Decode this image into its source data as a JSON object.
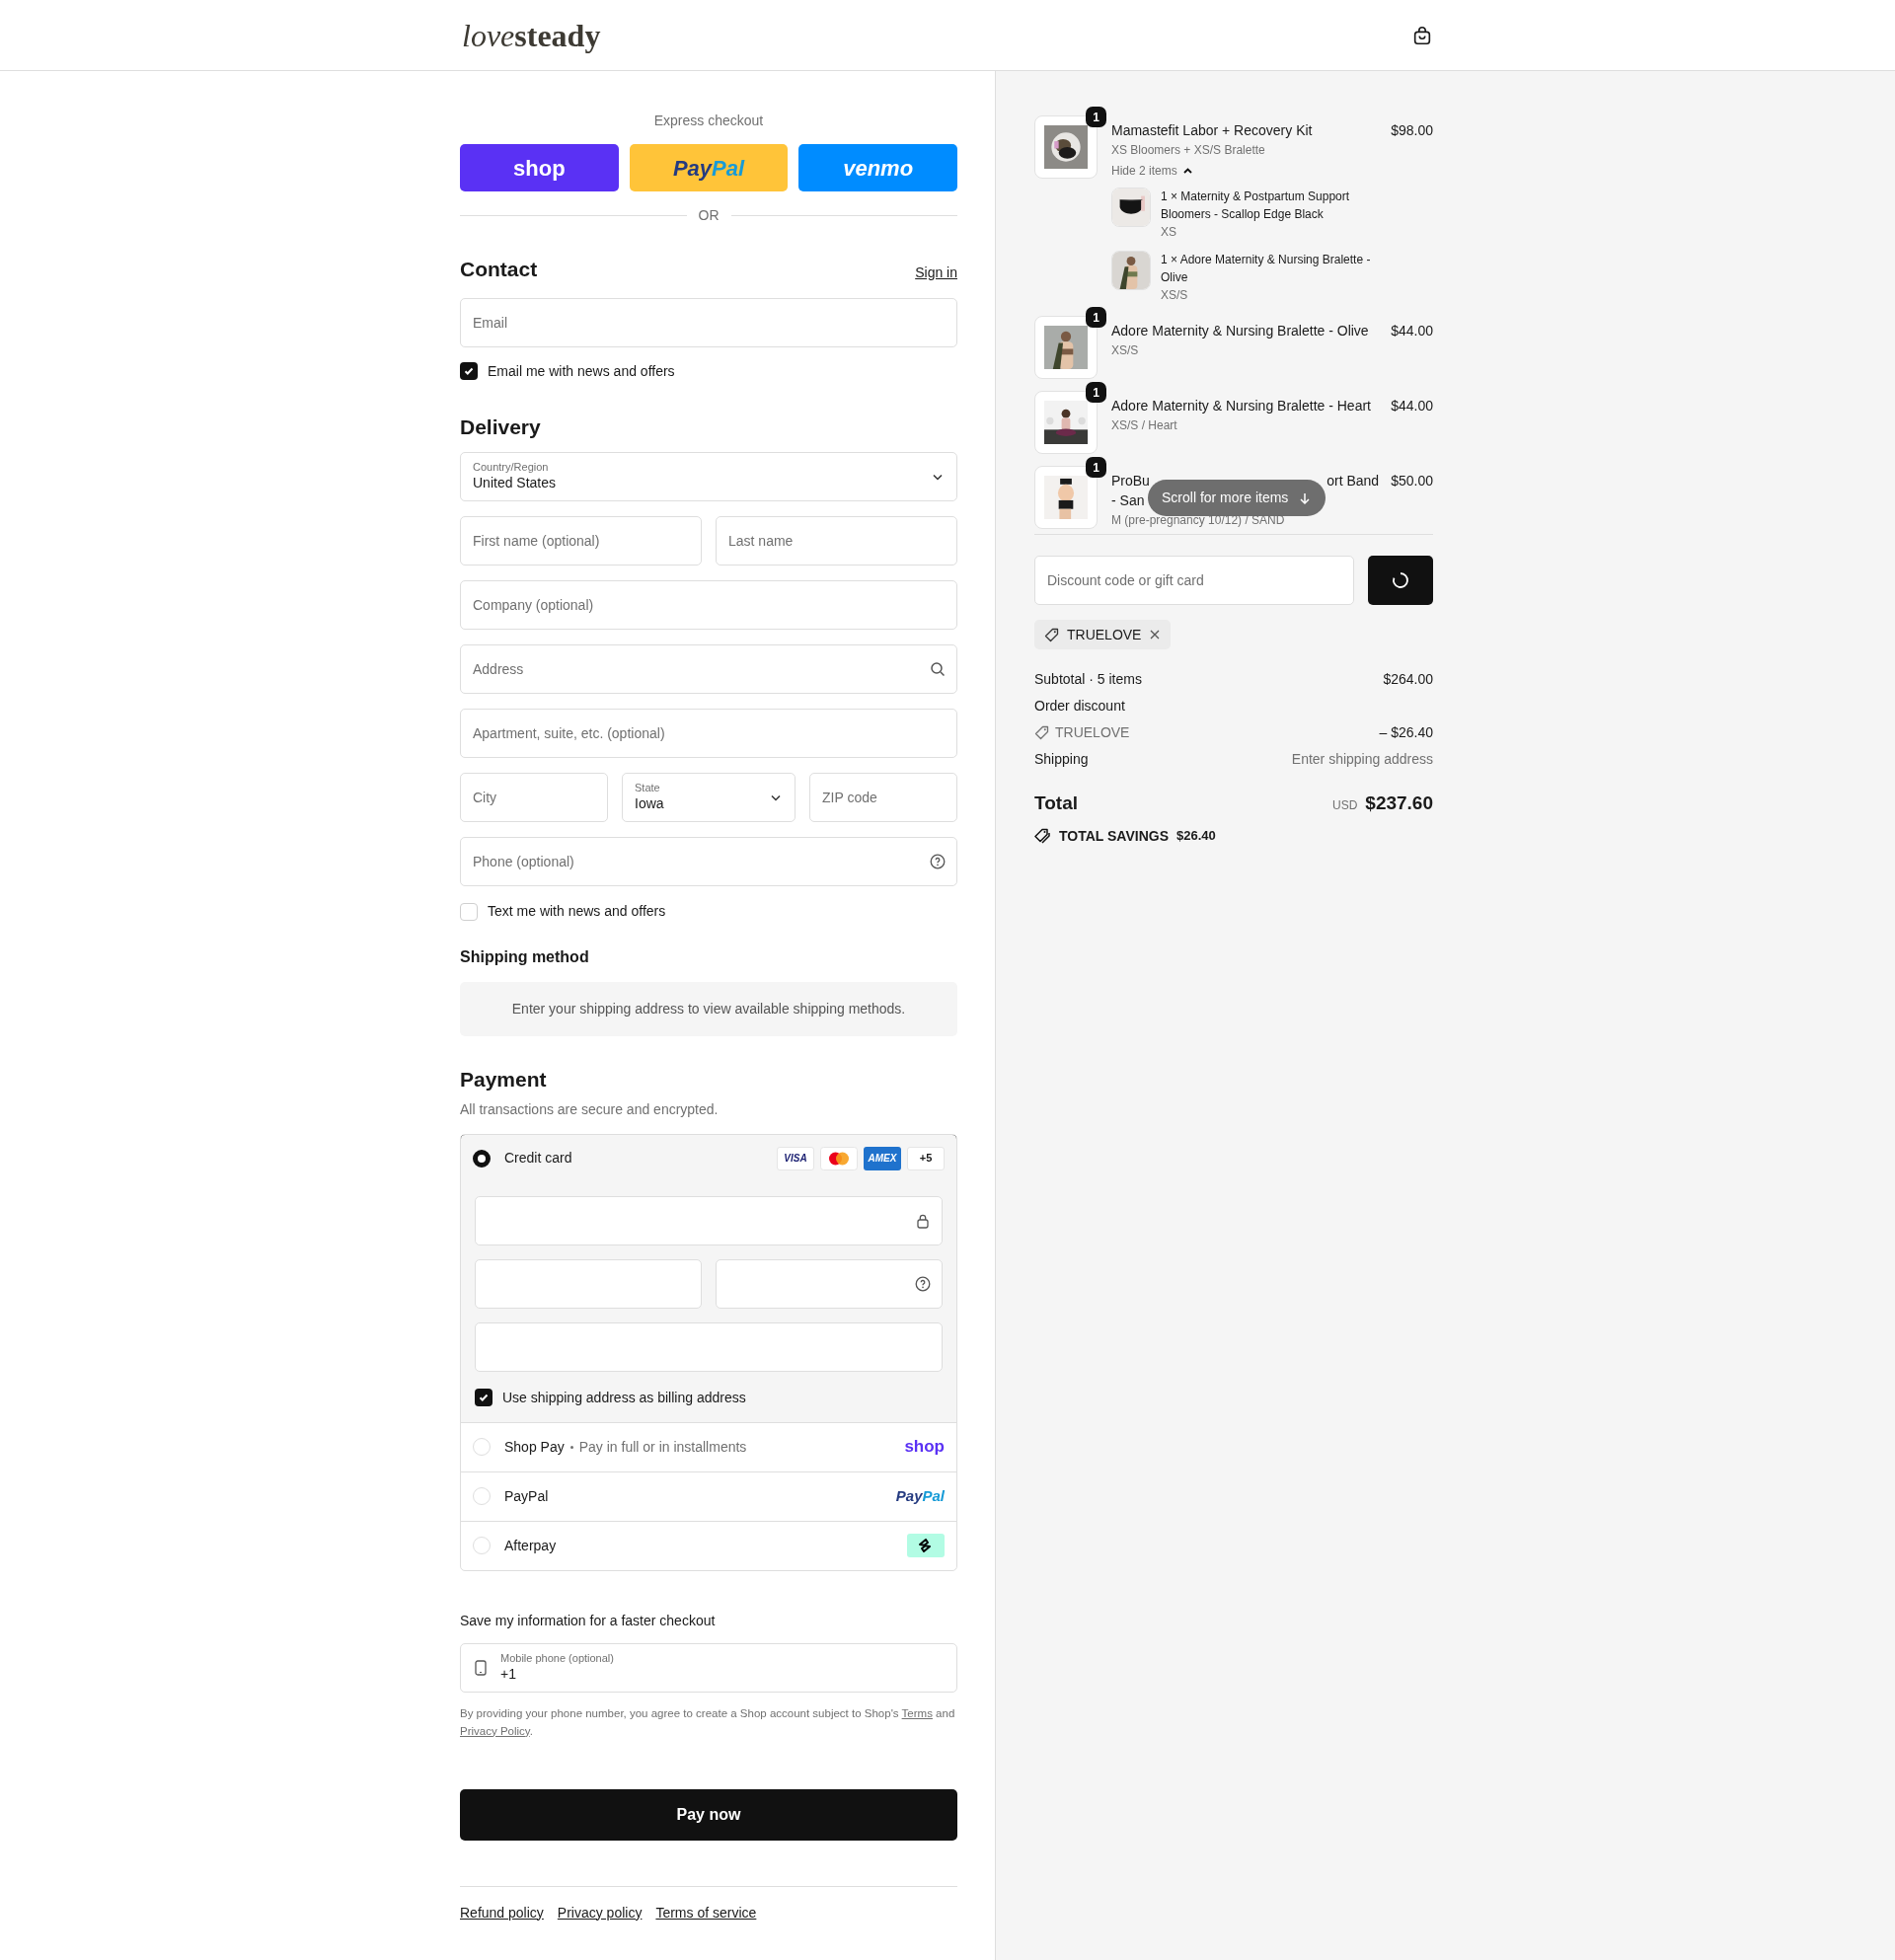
{
  "header": {
    "logo_parts": [
      "love",
      "steady"
    ]
  },
  "express": {
    "label": "Express checkout",
    "buttons": [
      {
        "kind": "shop",
        "parts": [
          "shop"
        ]
      },
      {
        "kind": "paypal",
        "parts": [
          "Pay",
          "Pal"
        ]
      },
      {
        "kind": "venmo",
        "parts": [
          "venmo"
        ]
      }
    ],
    "divider": "OR"
  },
  "contact": {
    "heading": "Contact",
    "sign_in": "Sign in",
    "email_placeholder": "Email",
    "newsletter": {
      "label": "Email me with news and offers",
      "checked": true
    }
  },
  "delivery": {
    "heading": "Delivery",
    "rows": [
      [
        {
          "kind": "select",
          "label": "Country/Region",
          "value": "United States"
        }
      ],
      [
        {
          "kind": "text",
          "placeholder": "First name (optional)"
        },
        {
          "kind": "text",
          "placeholder": "Last name"
        }
      ],
      [
        {
          "kind": "text",
          "placeholder": "Company (optional)"
        }
      ],
      [
        {
          "kind": "search",
          "placeholder": "Address"
        }
      ],
      [
        {
          "kind": "text",
          "placeholder": "Apartment, suite, etc. (optional)"
        }
      ],
      [
        {
          "kind": "text",
          "placeholder": "City"
        },
        {
          "kind": "select",
          "label": "State",
          "value": "Iowa"
        },
        {
          "kind": "text",
          "placeholder": "ZIP code"
        }
      ],
      [
        {
          "kind": "help",
          "placeholder": "Phone (optional)"
        }
      ]
    ],
    "sms": {
      "label": "Text me with news and offers",
      "checked": false
    }
  },
  "shipping_method": {
    "heading": "Shipping method",
    "message": "Enter your shipping address to view available shipping methods."
  },
  "payment": {
    "heading": "Payment",
    "subtitle": "All transactions are secure and encrypted.",
    "methods": [
      {
        "kind": "card",
        "label": "Credit card",
        "selected": true,
        "brands": [
          {
            "kind": "visa",
            "text": "VISA"
          },
          {
            "kind": "mastercard"
          },
          {
            "kind": "amex",
            "text": "AMEX"
          }
        ],
        "more": "+5",
        "field_rows": [
          [
            {
              "kind": "lock"
            }
          ],
          [
            {
              "kind": "text"
            },
            {
              "kind": "help"
            }
          ],
          [
            {
              "kind": "text"
            }
          ]
        ],
        "billing": {
          "label": "Use shipping address as billing address",
          "checked": true
        }
      },
      {
        "kind": "shop_pay",
        "label": "Shop Pay",
        "note": "Pay in full or in installments",
        "selected": false,
        "logo_parts": [
          "shop"
        ]
      },
      {
        "kind": "paypal",
        "label": "PayPal",
        "selected": false,
        "logo_parts": [
          "Pay",
          "Pal"
        ]
      },
      {
        "kind": "afterpay",
        "label": "Afterpay",
        "selected": false
      }
    ]
  },
  "save_info": {
    "heading": "Save my information for a faster checkout",
    "mobile": {
      "label": "Mobile phone (optional)",
      "value": "+1"
    },
    "legal": [
      {
        "kind": "text",
        "text": "By providing your phone number, you agree to create a Shop account subject to Shop's "
      },
      {
        "kind": "link",
        "text": "Terms"
      },
      {
        "kind": "text",
        "text": " and "
      },
      {
        "kind": "link",
        "text": "Privacy Policy"
      },
      {
        "kind": "text",
        "text": "."
      }
    ]
  },
  "pay_button": "Pay now",
  "footer_links": [
    "Refund policy",
    "Privacy policy",
    "Terms of service"
  ],
  "summary": {
    "items": [
      {
        "quantity": "1",
        "title_parts": [
          "Mamastefit Labor + Recovery Kit"
        ],
        "variant": "XS Bloomers + XS/S Bralette",
        "price": "$98.00",
        "toggle": "Hide 2 items",
        "expanded": true,
        "children": [
          {
            "title": "1 × Maternity & Postpartum Support Bloomers - Scallop Edge Black",
            "variant": "XS"
          },
          {
            "title": "1 × Adore Maternity & Nursing Bralette - Olive",
            "variant": "XS/S"
          }
        ]
      },
      {
        "quantity": "1",
        "title_parts": [
          "Adore Maternity & Nursing Bralette - Olive"
        ],
        "variant": "XS/S",
        "price": "$44.00"
      },
      {
        "quantity": "1",
        "title_parts": [
          "Adore Maternity & Nursing Bralette - Heart"
        ],
        "variant": "XS/S / Heart",
        "price": "$44.00"
      },
      {
        "quantity": "1",
        "title_parts": [
          "ProBu",
          "ort Band",
          "- San"
        ],
        "variant": "M (pre-pregnancy 10/12) / SAND",
        "price": "$50.00"
      }
    ],
    "scroll_hint": "Scroll for more items",
    "discount": {
      "placeholder": "Discount code or gift card",
      "loading": true
    },
    "applied_code": "TRUELOVE",
    "lines": [
      {
        "kind": "row",
        "label": "Subtotal · 5 items",
        "value": "$264.00"
      },
      {
        "kind": "heading",
        "label": "Order discount"
      },
      {
        "kind": "code",
        "label": "TRUELOVE",
        "value": "– $26.40"
      },
      {
        "kind": "muted_value",
        "label": "Shipping",
        "value": "Enter shipping address"
      }
    ],
    "total": {
      "label": "Total",
      "currency": "USD",
      "value": "$237.60"
    },
    "savings": {
      "label": "TOTAL SAVINGS",
      "value": "$26.40"
    }
  }
}
